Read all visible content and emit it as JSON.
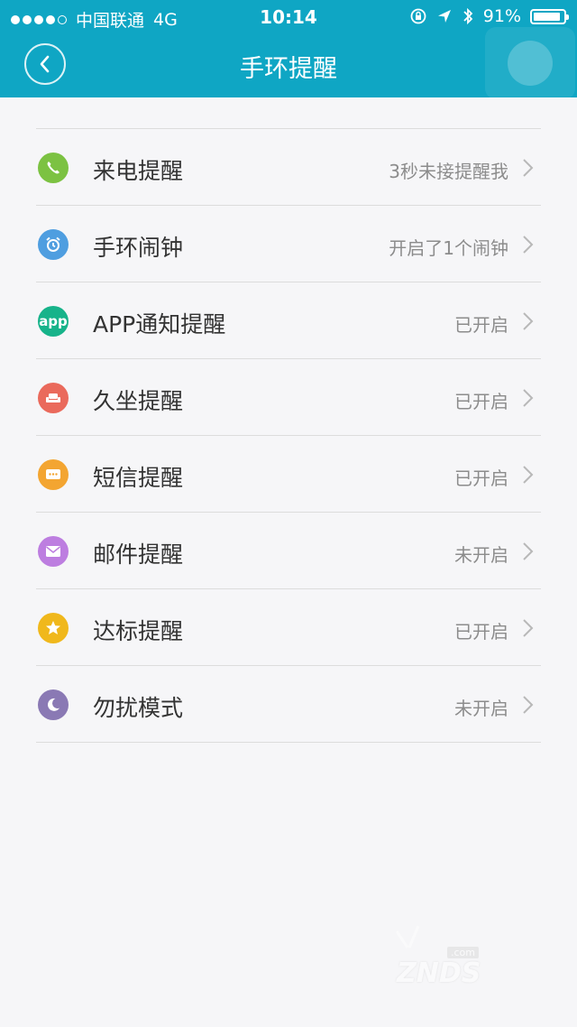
{
  "status_bar": {
    "carrier": "中国联通",
    "network": "4G",
    "time": "10:14",
    "battery": "91%",
    "battery_level": 0.91
  },
  "header": {
    "title": "手环提醒"
  },
  "items": [
    {
      "label": "来电提醒",
      "value": "3秒未接提醒我",
      "icon": "phone-icon",
      "color": "#7cc242"
    },
    {
      "label": "手环闹钟",
      "value": "开启了1个闹钟",
      "icon": "alarm-clock-icon",
      "color": "#4f9ee0"
    },
    {
      "label": "APP通知提醒",
      "value": "已开启",
      "icon": "app-icon",
      "icon_text": "app",
      "color": "#17b38a"
    },
    {
      "label": "久坐提醒",
      "value": "已开启",
      "icon": "chair-icon",
      "color": "#ea6a5c"
    },
    {
      "label": "短信提醒",
      "value": "已开启",
      "icon": "message-icon",
      "color": "#f3a531"
    },
    {
      "label": "邮件提醒",
      "value": "未开启",
      "icon": "mail-icon",
      "color": "#bd7ee0"
    },
    {
      "label": "达标提醒",
      "value": "已开启",
      "icon": "star-icon",
      "color": "#f0b81c"
    },
    {
      "label": "勿扰模式",
      "value": "未开启",
      "icon": "moon-icon",
      "color": "#8a79b4"
    }
  ],
  "watermark": {
    "text": "ZNDS",
    "sub": ".com"
  },
  "colors": {
    "header_bg": "#0fa6c4",
    "page_bg": "#f6f6f8"
  }
}
